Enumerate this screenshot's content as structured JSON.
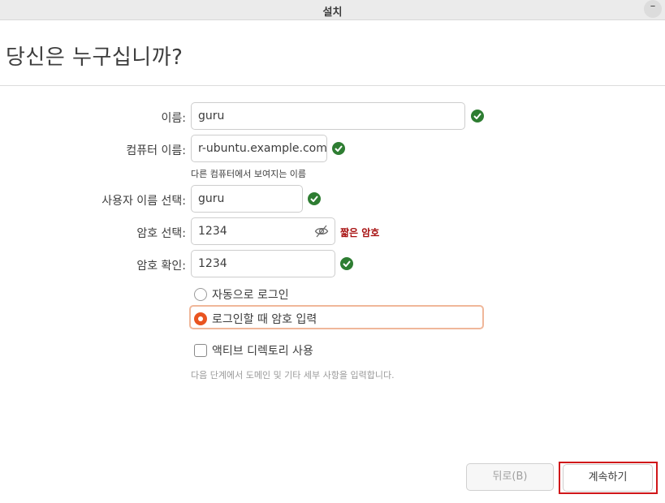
{
  "window": {
    "title": "설치",
    "minimize_label": "–"
  },
  "page": {
    "title": "당신은 누구십니까?"
  },
  "form": {
    "name": {
      "label": "이름:",
      "value": "guru"
    },
    "computer_name": {
      "label": "컴퓨터 이름:",
      "value": "r-ubuntu.example.com",
      "hint": "다른 컴퓨터에서 보여지는 이름"
    },
    "username": {
      "label": "사용자 이름 선택:",
      "value": "guru"
    },
    "password": {
      "label": "암호 선택:",
      "value": "1234",
      "strength": "짧은 암호"
    },
    "confirm": {
      "label": "암호 확인:",
      "value": "1234"
    },
    "login_options": {
      "auto": "자동으로 로그인",
      "require_password": "로그인할 때 암호 입력",
      "selected": "require_password"
    },
    "active_directory": {
      "label": "액티브 디렉토리 사용",
      "checked": false
    },
    "note": "다음 단계에서 도메인 및 기타 세부 사항을 입력합니다."
  },
  "buttons": {
    "back": "뒤로(B)",
    "next": "계속하기"
  },
  "colors": {
    "accent": "#e95420",
    "valid": "#2e7d32",
    "warning": "#a71010",
    "highlight": "#d0171a"
  },
  "icons": [
    "check-icon",
    "eye-slash-icon"
  ]
}
